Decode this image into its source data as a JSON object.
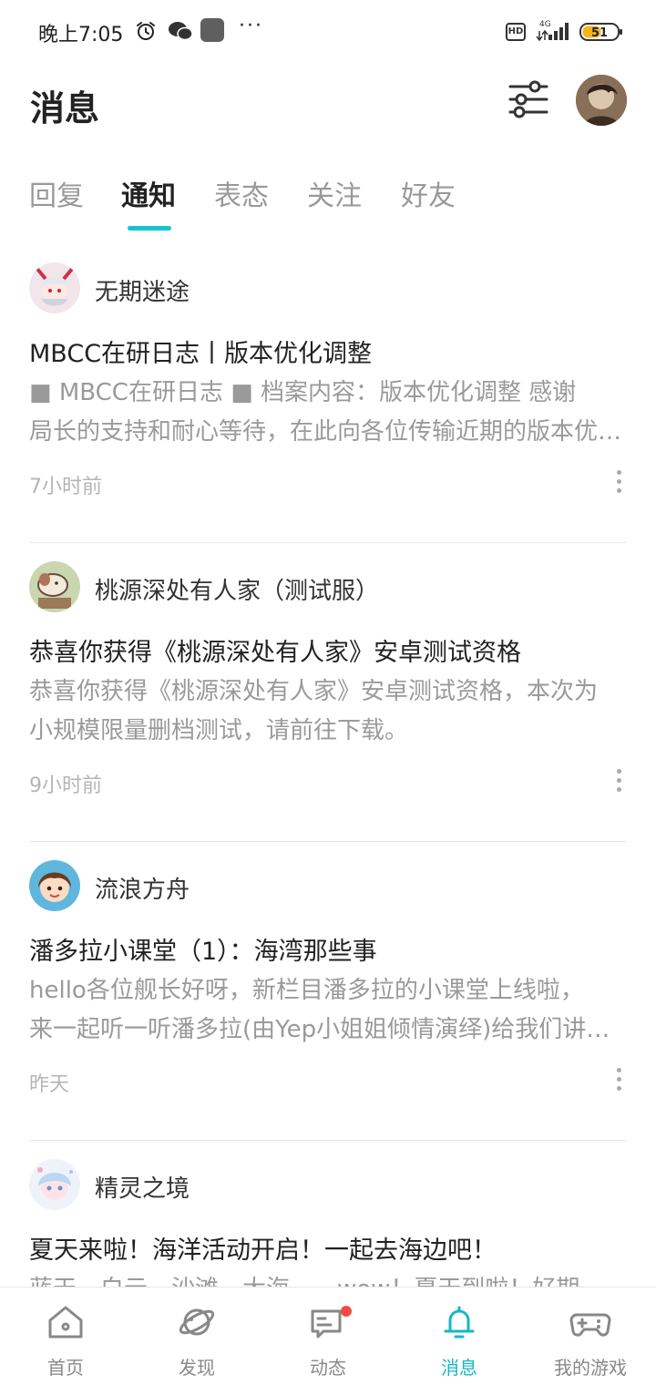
{
  "status_bar": {
    "time": "晚上7:05",
    "more": "···",
    "hd": "HD",
    "network": "4G",
    "battery": "51"
  },
  "header": {
    "title": "消息"
  },
  "tabs": [
    {
      "label": "回复",
      "active": false
    },
    {
      "label": "通知",
      "active": true
    },
    {
      "label": "表态",
      "active": false
    },
    {
      "label": "关注",
      "active": false
    },
    {
      "label": "好友",
      "active": false
    }
  ],
  "notifications": [
    {
      "author": "无期迷途",
      "title": "MBCC在研日志丨版本优化调整",
      "body_line1": "■ MBCC在研日志 ■ 档案内容：版本优化调整 感谢",
      "body_line2": "局长的支持和耐心等待，在此向各位传输近期的版本优化调整内容",
      "time": "7小时前"
    },
    {
      "author": "桃源深处有人家（测试服）",
      "title": "恭喜你获得《桃源深处有人家》安卓测试资格",
      "body_line1": "恭喜你获得《桃源深处有人家》安卓测试资格，本次为",
      "body_line2": "小规模限量删档测试，请前往下载。",
      "time": "9小时前"
    },
    {
      "author": "流浪方舟",
      "title": "潘多拉小课堂（1）：海湾那些事",
      "body_line1": "hello各位舰长好呀，新栏目潘多拉的小课堂上线啦，",
      "body_line2": "来一起听一听潘多拉(由Yep小姐姐倾情演绎)给我们讲讲海湾的故事",
      "time": "昨天"
    },
    {
      "author": "精灵之境",
      "title": "夏天来啦！海洋活动开启！一起去海边吧！",
      "body_line1": "蓝天、白云、沙滩、大海……wow！夏天到啦！好期待来",
      "body_line2": "",
      "time": ""
    }
  ],
  "bottom_nav": [
    {
      "label": "首页",
      "icon": "home-icon"
    },
    {
      "label": "发现",
      "icon": "planet-icon"
    },
    {
      "label": "动态",
      "icon": "message-card-icon"
    },
    {
      "label": "消息",
      "icon": "bell-icon"
    },
    {
      "label": "我的游戏",
      "icon": "gamepad-icon"
    }
  ],
  "colors": {
    "accent": "#15c5ce",
    "badge": "#f04b47"
  }
}
